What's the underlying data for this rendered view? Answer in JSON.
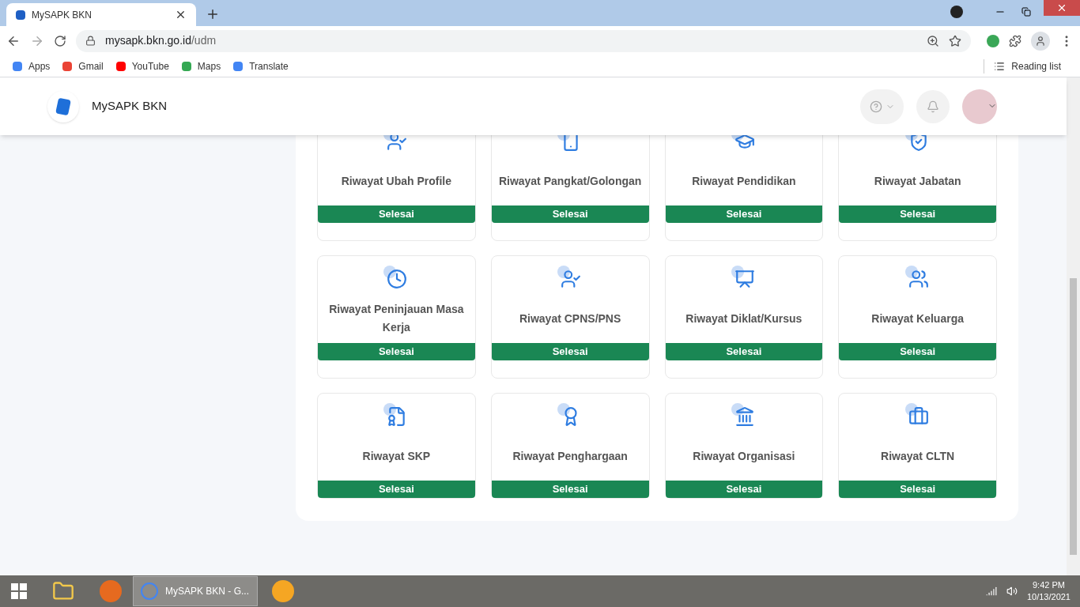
{
  "browser": {
    "tab_title": "MySAPK BKN",
    "url_host": "mysapk.bkn.go.id",
    "url_path": "/udm",
    "bookmarks": [
      "Apps",
      "Gmail",
      "YouTube",
      "Maps",
      "Translate"
    ],
    "reading_list": "Reading list"
  },
  "header": {
    "title": "MySAPK BKN"
  },
  "cards": [
    {
      "title": "Riwayat Ubah Profile",
      "status": "Selesai"
    },
    {
      "title": "Riwayat Pangkat/Golongan",
      "status": "Selesai"
    },
    {
      "title": "Riwayat Pendidikan",
      "status": "Selesai"
    },
    {
      "title": "Riwayat Jabatan",
      "status": "Selesai"
    },
    {
      "title": "Riwayat Peninjauan Masa Kerja",
      "status": "Selesai"
    },
    {
      "title": "Riwayat CPNS/PNS",
      "status": "Selesai"
    },
    {
      "title": "Riwayat Diklat/Kursus",
      "status": "Selesai"
    },
    {
      "title": "Riwayat Keluarga",
      "status": "Selesai"
    },
    {
      "title": "Riwayat SKP",
      "status": "Selesai"
    },
    {
      "title": "Riwayat Penghargaan",
      "status": "Selesai"
    },
    {
      "title": "Riwayat Organisasi",
      "status": "Selesai"
    },
    {
      "title": "Riwayat CLTN",
      "status": "Selesai"
    }
  ],
  "taskbar": {
    "window_title": "MySAPK BKN - G...",
    "time": "9:42 PM",
    "date": "10/13/2021"
  }
}
